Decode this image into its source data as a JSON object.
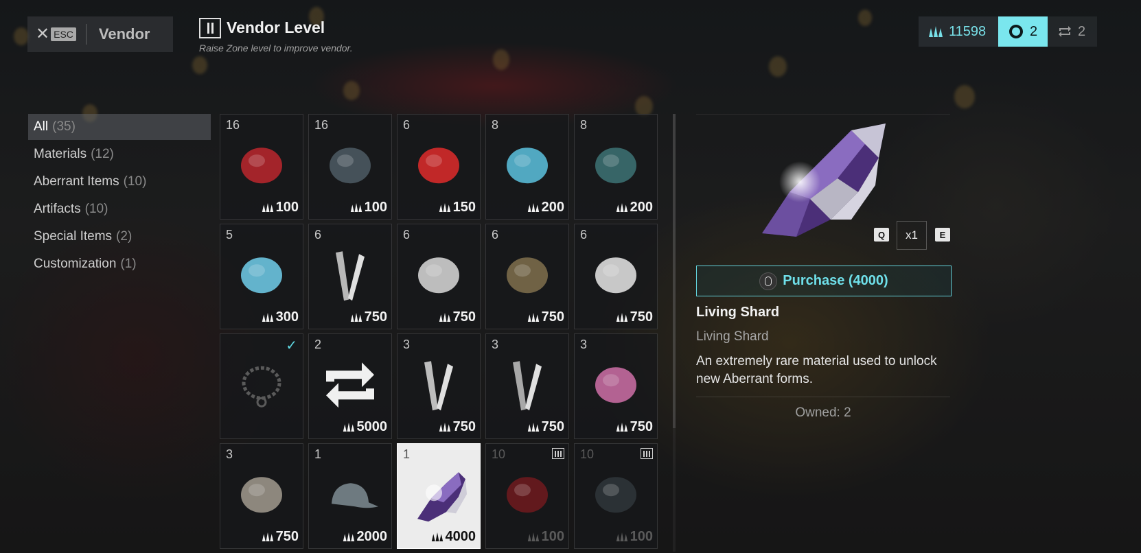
{
  "header": {
    "close_icon": "close-icon",
    "esc_key": "ESC",
    "title": "Vendor",
    "level_title": "Vendor Level",
    "level_subtitle": "Raise Zone level to improve vendor."
  },
  "currencies": [
    {
      "icon": "crown-currency-icon",
      "value": "11598"
    },
    {
      "icon": "circle-token-icon",
      "value": "2"
    },
    {
      "icon": "reroll-icon",
      "value": "2"
    }
  ],
  "categories": [
    {
      "label": "All",
      "count": "(35)",
      "active": true
    },
    {
      "label": "Materials",
      "count": "(12)",
      "active": false
    },
    {
      "label": "Aberrant Items",
      "count": "(10)",
      "active": false
    },
    {
      "label": "Artifacts",
      "count": "(10)",
      "active": false
    },
    {
      "label": "Special Items",
      "count": "(2)",
      "active": false
    },
    {
      "label": "Customization",
      "count": "(1)",
      "active": false
    }
  ],
  "items": [
    {
      "qty": "16",
      "price": "100",
      "icon": "red-tendril-material",
      "color": "#b3262c"
    },
    {
      "qty": "16",
      "price": "100",
      "icon": "dark-comet-material",
      "color": "#4a5860"
    },
    {
      "qty": "6",
      "price": "150",
      "icon": "red-core-material",
      "color": "#d42a2a"
    },
    {
      "qty": "8",
      "price": "200",
      "icon": "cyan-cloud-material",
      "color": "#58b8d4"
    },
    {
      "qty": "8",
      "price": "200",
      "icon": "teal-orb-material",
      "color": "#3b6e70"
    },
    {
      "qty": "5",
      "price": "300",
      "icon": "blue-burst-material",
      "color": "#6cc4e0"
    },
    {
      "qty": "6",
      "price": "750",
      "icon": "steel-shards-material",
      "color": "#b8b8b8"
    },
    {
      "qty": "6",
      "price": "750",
      "icon": "silver-crystal-material",
      "color": "#cfcfcf"
    },
    {
      "qty": "6",
      "price": "750",
      "icon": "rusted-fragment-material",
      "color": "#7a6a4a"
    },
    {
      "qty": "6",
      "price": "750",
      "icon": "white-cloth-material",
      "color": "#dcdcdc"
    },
    {
      "qty": "",
      "price": "",
      "icon": "chain-bracelet-item",
      "color": "#5a5a5a",
      "owned_check": "✓"
    },
    {
      "qty": "2",
      "price": "5000",
      "icon": "reroll-token-item",
      "color": "#f0f0f0"
    },
    {
      "qty": "3",
      "price": "750",
      "icon": "metal-beam-item",
      "color": "#bdbdbd"
    },
    {
      "qty": "3",
      "price": "750",
      "icon": "scaffold-item",
      "color": "#a8a8a8"
    },
    {
      "qty": "3",
      "price": "750",
      "icon": "colorful-bundle-item",
      "color": "#c46aa0"
    },
    {
      "qty": "3",
      "price": "750",
      "icon": "smoke-skull-item",
      "color": "#9a9488"
    },
    {
      "qty": "1",
      "price": "2000",
      "icon": "cap-customization",
      "color": "#6e7a80"
    },
    {
      "qty": "1",
      "price": "4000",
      "icon": "living-shard-item",
      "color": "#5a3a8a",
      "selected": true
    },
    {
      "qty": "10",
      "price": "100",
      "icon": "red-tendril-material",
      "color": "#6a1a1e",
      "locked": true
    },
    {
      "qty": "10",
      "price": "100",
      "icon": "dark-comet-material",
      "color": "#2e3438",
      "locked": true
    }
  ],
  "detail": {
    "key_prev": "Q",
    "key_next": "E",
    "quantity": "x1",
    "purchase_label": "Purchase (4000)",
    "name": "Living Shard",
    "type": "Living Shard",
    "description": "An extremely rare material used to unlock new Aberrant forms.",
    "owned": "Owned: 2"
  }
}
